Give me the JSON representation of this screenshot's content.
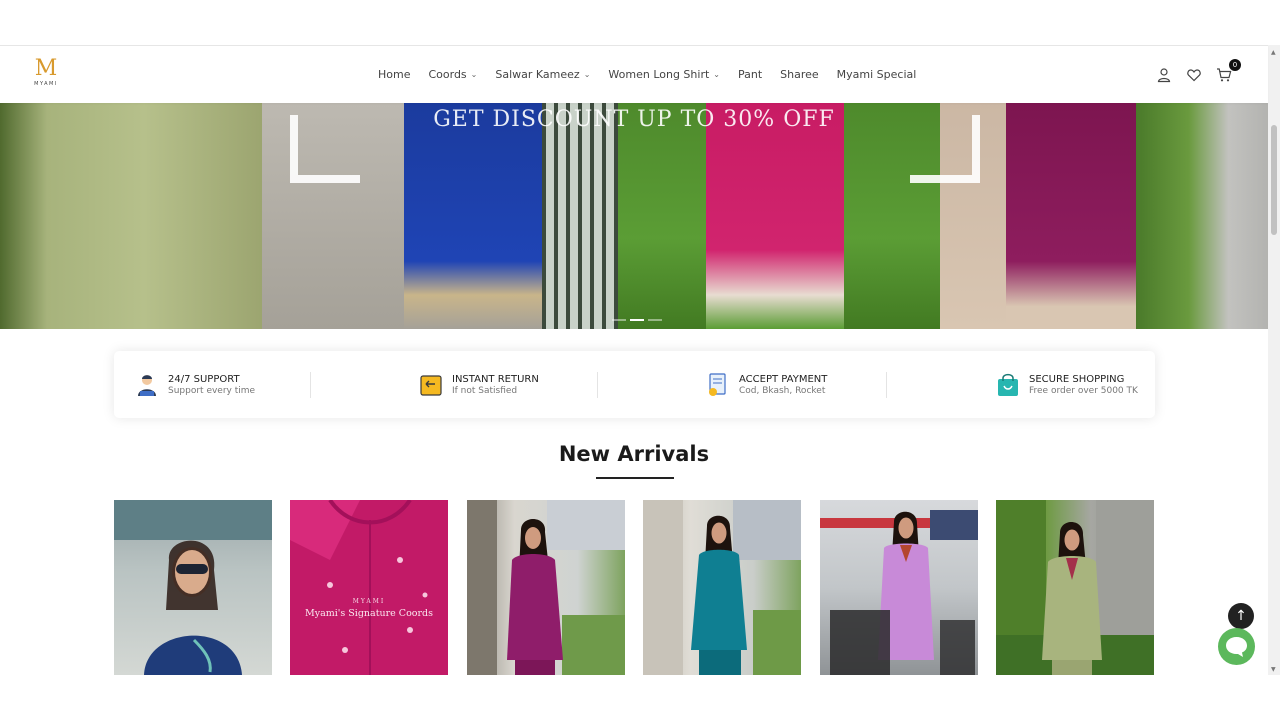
{
  "brand": {
    "logo_letter": "M",
    "logo_word": "MYAMI",
    "accent": "#d89a2e"
  },
  "nav": {
    "items": [
      {
        "label": "Home",
        "dropdown": false
      },
      {
        "label": "Coords",
        "dropdown": true
      },
      {
        "label": "Salwar Kameez",
        "dropdown": true
      },
      {
        "label": "Women Long Shirt",
        "dropdown": true
      },
      {
        "label": "Pant",
        "dropdown": false
      },
      {
        "label": "Sharee",
        "dropdown": false
      },
      {
        "label": "Myami Special",
        "dropdown": false
      }
    ],
    "icons": [
      "user-icon",
      "heart-icon",
      "cart-icon"
    ],
    "cart_count": "0"
  },
  "hero": {
    "title": "GET DISCOUNT UP TO 30% OFF",
    "slide_count": 3,
    "active_slide": 1
  },
  "features": [
    {
      "icon": "support-agent-icon",
      "title": "24/7 SUPPORT",
      "subtitle": "Support every time"
    },
    {
      "icon": "return-box-icon",
      "title": "INSTANT RETURN",
      "subtitle": "If not Satisfied"
    },
    {
      "icon": "payment-receipt-icon",
      "title": "ACCEPT PAYMENT",
      "subtitle": "Cod, Bkash, Rocket"
    },
    {
      "icon": "shopping-bag-icon",
      "title": "SECURE SHOPPING",
      "subtitle": "Free order over 5000 TK"
    }
  ],
  "new_arrivals": {
    "title": "New Arrivals",
    "products": [
      {
        "image": "woman-navy-embroidered-top"
      },
      {
        "image": "pink-coords-fabric",
        "overlay_brand": "MYAMI",
        "overlay_text": "Myami's Signature Coords"
      },
      {
        "image": "woman-magenta-kurti"
      },
      {
        "image": "woman-teal-salwar"
      },
      {
        "image": "woman-lavender-kurti"
      },
      {
        "image": "woman-sage-kurti"
      }
    ]
  },
  "floating": {
    "back_to_top": "↑",
    "chat": "chat-bubble-icon"
  },
  "colors": {
    "chat_green": "#5cb85c",
    "dark": "#222222"
  }
}
